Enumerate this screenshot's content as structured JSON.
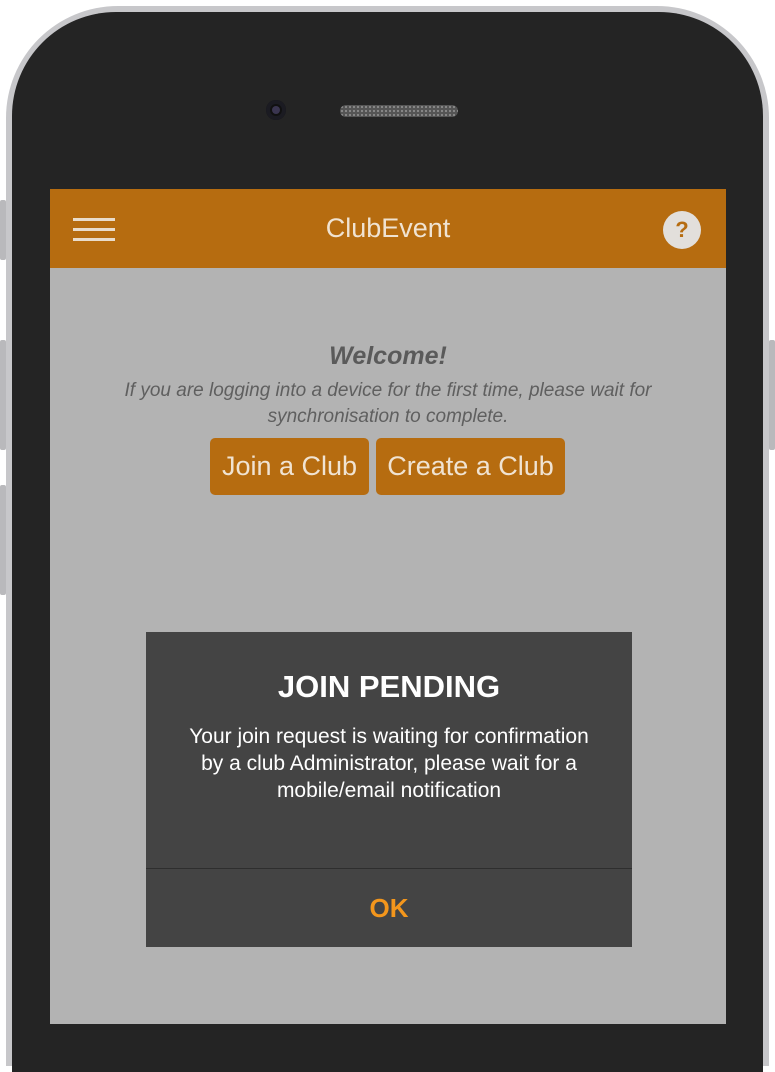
{
  "app": {
    "title": "ClubEvent",
    "help_label": "?",
    "header_color": "#b66c10"
  },
  "icons": {
    "menu": "hamburger-menu-icon",
    "help": "help-circle-icon"
  },
  "welcome": {
    "title": "Welcome!",
    "message": "If you are logging into a device for the first time, please wait for synchronisation to complete."
  },
  "buttons": {
    "join_club": "Join a Club",
    "create_club": "Create a Club"
  },
  "dialog": {
    "title": "JOIN PENDING",
    "message": "Your join request is waiting for confirmation by a club Administrator, please wait for a mobile/email notification",
    "ok_label": "OK",
    "ok_color": "#f3961c"
  }
}
